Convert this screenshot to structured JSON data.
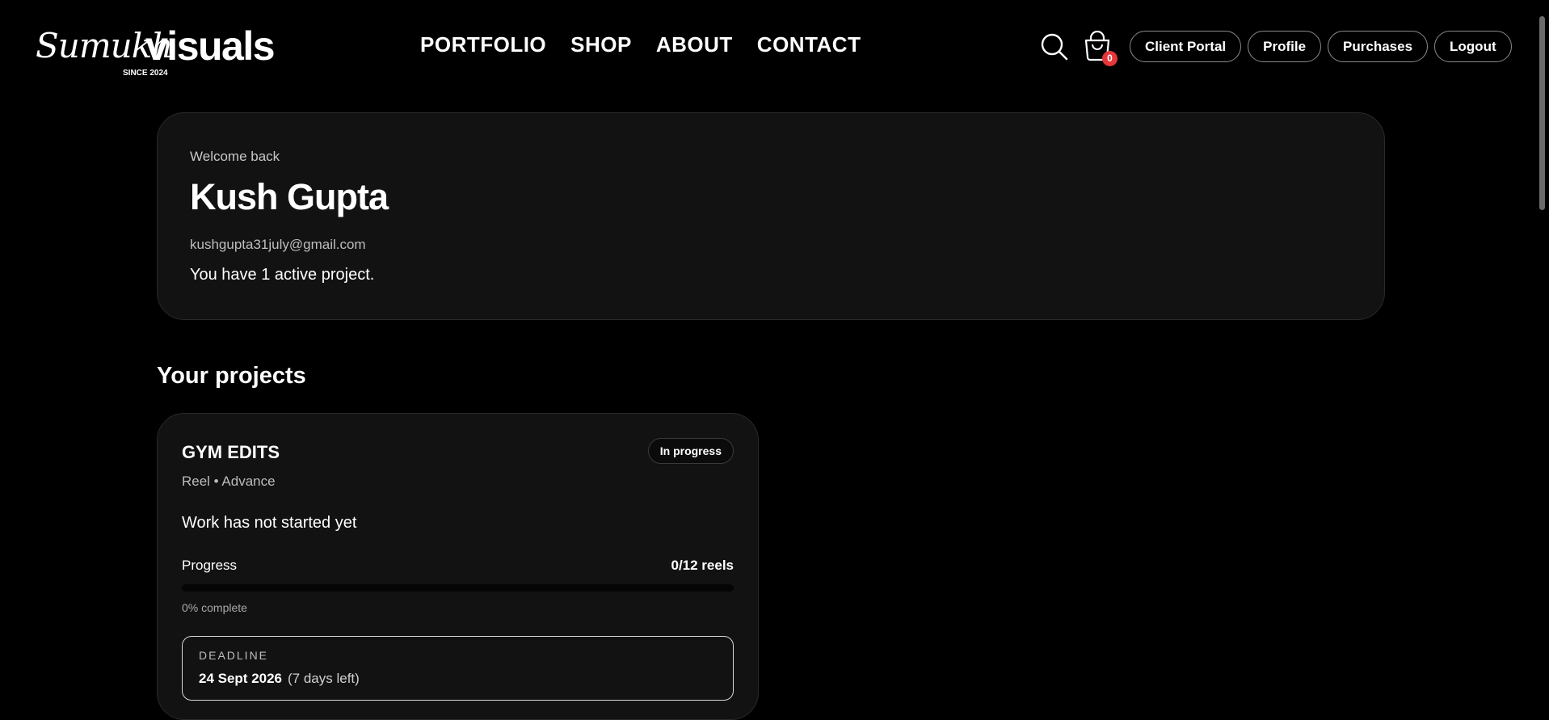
{
  "brand": {
    "script": "Sumukh",
    "bold": "visuals",
    "since": "SINCE 2024"
  },
  "nav": {
    "items": [
      {
        "label": "PORTFOLIO"
      },
      {
        "label": "SHOP"
      },
      {
        "label": "ABOUT"
      },
      {
        "label": "CONTACT"
      }
    ]
  },
  "header_actions": {
    "search_icon": "search-icon",
    "cart_icon": "shopping-bag-icon",
    "cart_count": "0",
    "buttons": [
      {
        "label": "Client Portal"
      },
      {
        "label": "Profile"
      },
      {
        "label": "Purchases"
      },
      {
        "label": "Logout"
      }
    ]
  },
  "welcome": {
    "subtitle": "Welcome back",
    "name": "Kush Gupta",
    "email": "kushgupta31july@gmail.com",
    "active_text": "You have 1 active project."
  },
  "projects": {
    "title": "Your projects",
    "items": [
      {
        "name": "GYM EDITS",
        "status": "In progress",
        "meta": "Reel • Advance",
        "status_text": "Work has not started yet",
        "progress_label": "Progress",
        "progress_count": "0/12 reels",
        "progress_fraction": 0,
        "progress_pct_text": "0% complete",
        "deadline_label": "DEADLINE",
        "deadline_date": "24 Sept 2026",
        "deadline_left": "(7 days left)"
      }
    ]
  },
  "colors": {
    "background": "#000000",
    "card": "#121212",
    "badge_red": "#e5363a"
  }
}
